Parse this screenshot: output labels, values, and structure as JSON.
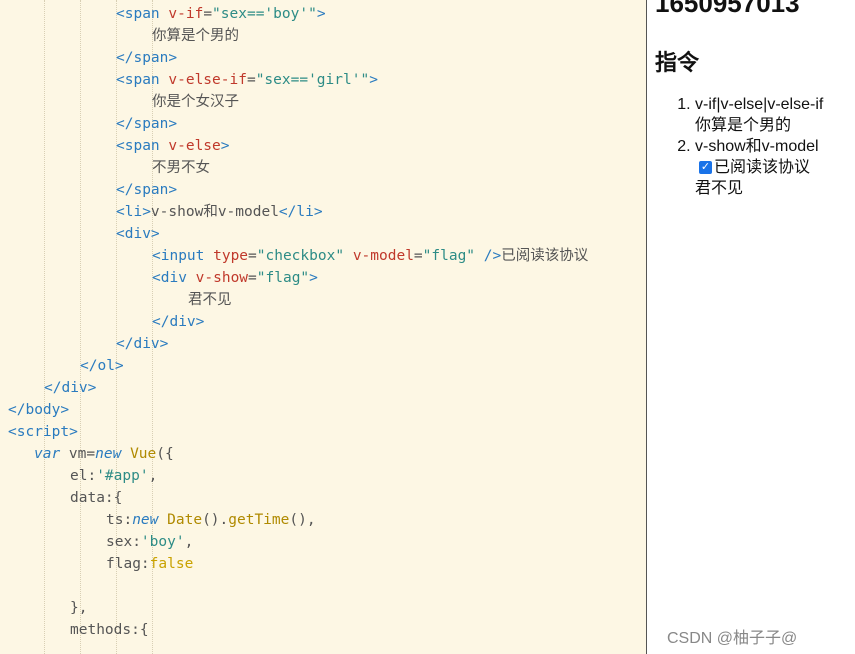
{
  "editor": {
    "lines": [
      {
        "indent": 116,
        "tokens": [
          [
            "tag",
            "<span "
          ],
          [
            "attr",
            "v-if"
          ],
          [
            "op",
            "="
          ],
          [
            "str",
            "\"sex=='boy'\""
          ],
          [
            "tag",
            ">"
          ]
        ]
      },
      {
        "indent": 152,
        "tokens": [
          [
            "text",
            "你算是个男的"
          ]
        ]
      },
      {
        "indent": 116,
        "tokens": [
          [
            "tag",
            "</span>"
          ]
        ]
      },
      {
        "indent": 116,
        "tokens": [
          [
            "tag",
            "<span "
          ],
          [
            "attr",
            "v-else-if"
          ],
          [
            "op",
            "="
          ],
          [
            "str",
            "\"sex=='girl'\""
          ],
          [
            "tag",
            ">"
          ]
        ]
      },
      {
        "indent": 152,
        "tokens": [
          [
            "text",
            "你是个女汉子"
          ]
        ]
      },
      {
        "indent": 116,
        "tokens": [
          [
            "tag",
            "</span>"
          ]
        ]
      },
      {
        "indent": 116,
        "tokens": [
          [
            "tag",
            "<span "
          ],
          [
            "attr",
            "v-else"
          ],
          [
            "tag",
            ">"
          ]
        ]
      },
      {
        "indent": 152,
        "tokens": [
          [
            "text",
            "不男不女"
          ]
        ]
      },
      {
        "indent": 116,
        "tokens": [
          [
            "tag",
            "</span>"
          ]
        ]
      },
      {
        "indent": 116,
        "tokens": [
          [
            "tag",
            "<li>"
          ],
          [
            "var",
            "v-show"
          ],
          [
            "text",
            "和"
          ],
          [
            "var",
            "v-model"
          ],
          [
            "tag",
            "</li>"
          ]
        ]
      },
      {
        "indent": 116,
        "tokens": [
          [
            "tag",
            "<div>"
          ]
        ]
      },
      {
        "indent": 152,
        "tokens": [
          [
            "tag",
            "<input "
          ],
          [
            "attr",
            "type"
          ],
          [
            "op",
            "="
          ],
          [
            "str",
            "\"checkbox\""
          ],
          [
            "op",
            " "
          ],
          [
            "attr",
            "v-model"
          ],
          [
            "op",
            "="
          ],
          [
            "str",
            "\"flag\""
          ],
          [
            "tag",
            " />"
          ],
          [
            "text",
            "已阅读该协议"
          ]
        ]
      },
      {
        "indent": 152,
        "tokens": [
          [
            "tag",
            "<div "
          ],
          [
            "attr",
            "v-show"
          ],
          [
            "op",
            "="
          ],
          [
            "str",
            "\"flag\""
          ],
          [
            "tag",
            ">"
          ]
        ]
      },
      {
        "indent": 188,
        "tokens": [
          [
            "text",
            "君不见"
          ]
        ]
      },
      {
        "indent": 152,
        "tokens": [
          [
            "tag",
            "</div>"
          ]
        ]
      },
      {
        "indent": 116,
        "tokens": [
          [
            "tag",
            "</div>"
          ]
        ]
      },
      {
        "indent": 80,
        "tokens": [
          [
            "tag",
            "</ol>"
          ]
        ]
      },
      {
        "indent": 44,
        "tokens": [
          [
            "tag",
            "</div>"
          ]
        ]
      },
      {
        "indent": 8,
        "tokens": [
          [
            "tag",
            "</body>"
          ]
        ]
      },
      {
        "indent": 8,
        "tokens": [
          [
            "tag",
            "<script>"
          ]
        ]
      },
      {
        "indent": 34,
        "tokens": [
          [
            "kw",
            "var"
          ],
          [
            "op",
            " vm="
          ],
          [
            "kw",
            "new"
          ],
          [
            "op",
            " "
          ],
          [
            "call",
            "Vue"
          ],
          [
            "op",
            "({"
          ]
        ]
      },
      {
        "indent": 70,
        "tokens": [
          [
            "prop",
            "el:"
          ],
          [
            "str",
            "'#app'"
          ],
          [
            "op",
            ","
          ]
        ]
      },
      {
        "indent": 70,
        "tokens": [
          [
            "prop",
            "data:{"
          ]
        ]
      },
      {
        "indent": 106,
        "tokens": [
          [
            "prop",
            "ts:"
          ],
          [
            "kw",
            "new"
          ],
          [
            "op",
            " "
          ],
          [
            "call",
            "Date"
          ],
          [
            "op",
            "()."
          ],
          [
            "call",
            "getTime"
          ],
          [
            "op",
            "(),"
          ]
        ]
      },
      {
        "indent": 106,
        "tokens": [
          [
            "prop",
            "sex:"
          ],
          [
            "str",
            "'boy'"
          ],
          [
            "op",
            ","
          ]
        ]
      },
      {
        "indent": 106,
        "tokens": [
          [
            "prop",
            "flag:"
          ],
          [
            "bool",
            "false"
          ]
        ]
      },
      {
        "indent": 106,
        "tokens": []
      },
      {
        "indent": 70,
        "tokens": [
          [
            "op",
            "},"
          ]
        ]
      },
      {
        "indent": 70,
        "tokens": [
          [
            "prop",
            "methods:{"
          ]
        ]
      },
      {
        "indent": 106,
        "tokens": []
      }
    ]
  },
  "preview": {
    "timestamp": "1650957013",
    "heading": "指令",
    "items": [
      {
        "label": "v-if|v-else|v-else-if",
        "sub": "你算是个男的"
      },
      {
        "label": "v-show和v-model",
        "checkbox_label": "已阅读该协议",
        "checked": true,
        "sub": "君不见"
      }
    ],
    "watermark": "CSDN @柚子子@"
  },
  "colors": {
    "editor_bg": "#fdf7e4",
    "tag": "#2a7bbf",
    "attr": "#c0392b",
    "string": "#2d8c86",
    "checkbox": "#1a73e8"
  }
}
